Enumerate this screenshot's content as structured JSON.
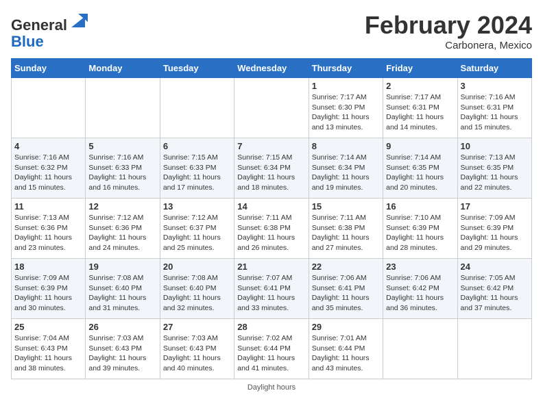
{
  "header": {
    "title": "February 2024",
    "location": "Carbonera, Mexico",
    "logo_line1": "General",
    "logo_line2": "Blue"
  },
  "days_of_week": [
    "Sunday",
    "Monday",
    "Tuesday",
    "Wednesday",
    "Thursday",
    "Friday",
    "Saturday"
  ],
  "weeks": [
    [
      {
        "day": "",
        "sunrise": "",
        "sunset": "",
        "daylight": "",
        "empty": true
      },
      {
        "day": "",
        "sunrise": "",
        "sunset": "",
        "daylight": "",
        "empty": true
      },
      {
        "day": "",
        "sunrise": "",
        "sunset": "",
        "daylight": "",
        "empty": true
      },
      {
        "day": "",
        "sunrise": "",
        "sunset": "",
        "daylight": "",
        "empty": true
      },
      {
        "day": "1",
        "sunrise": "7:17 AM",
        "sunset": "6:30 PM",
        "daylight": "11 hours and 13 minutes."
      },
      {
        "day": "2",
        "sunrise": "7:17 AM",
        "sunset": "6:31 PM",
        "daylight": "11 hours and 14 minutes."
      },
      {
        "day": "3",
        "sunrise": "7:16 AM",
        "sunset": "6:31 PM",
        "daylight": "11 hours and 15 minutes."
      }
    ],
    [
      {
        "day": "4",
        "sunrise": "7:16 AM",
        "sunset": "6:32 PM",
        "daylight": "11 hours and 15 minutes."
      },
      {
        "day": "5",
        "sunrise": "7:16 AM",
        "sunset": "6:33 PM",
        "daylight": "11 hours and 16 minutes."
      },
      {
        "day": "6",
        "sunrise": "7:15 AM",
        "sunset": "6:33 PM",
        "daylight": "11 hours and 17 minutes."
      },
      {
        "day": "7",
        "sunrise": "7:15 AM",
        "sunset": "6:34 PM",
        "daylight": "11 hours and 18 minutes."
      },
      {
        "day": "8",
        "sunrise": "7:14 AM",
        "sunset": "6:34 PM",
        "daylight": "11 hours and 19 minutes."
      },
      {
        "day": "9",
        "sunrise": "7:14 AM",
        "sunset": "6:35 PM",
        "daylight": "11 hours and 20 minutes."
      },
      {
        "day": "10",
        "sunrise": "7:13 AM",
        "sunset": "6:35 PM",
        "daylight": "11 hours and 22 minutes."
      }
    ],
    [
      {
        "day": "11",
        "sunrise": "7:13 AM",
        "sunset": "6:36 PM",
        "daylight": "11 hours and 23 minutes."
      },
      {
        "day": "12",
        "sunrise": "7:12 AM",
        "sunset": "6:36 PM",
        "daylight": "11 hours and 24 minutes."
      },
      {
        "day": "13",
        "sunrise": "7:12 AM",
        "sunset": "6:37 PM",
        "daylight": "11 hours and 25 minutes."
      },
      {
        "day": "14",
        "sunrise": "7:11 AM",
        "sunset": "6:38 PM",
        "daylight": "11 hours and 26 minutes."
      },
      {
        "day": "15",
        "sunrise": "7:11 AM",
        "sunset": "6:38 PM",
        "daylight": "11 hours and 27 minutes."
      },
      {
        "day": "16",
        "sunrise": "7:10 AM",
        "sunset": "6:39 PM",
        "daylight": "11 hours and 28 minutes."
      },
      {
        "day": "17",
        "sunrise": "7:09 AM",
        "sunset": "6:39 PM",
        "daylight": "11 hours and 29 minutes."
      }
    ],
    [
      {
        "day": "18",
        "sunrise": "7:09 AM",
        "sunset": "6:39 PM",
        "daylight": "11 hours and 30 minutes."
      },
      {
        "day": "19",
        "sunrise": "7:08 AM",
        "sunset": "6:40 PM",
        "daylight": "11 hours and 31 minutes."
      },
      {
        "day": "20",
        "sunrise": "7:08 AM",
        "sunset": "6:40 PM",
        "daylight": "11 hours and 32 minutes."
      },
      {
        "day": "21",
        "sunrise": "7:07 AM",
        "sunset": "6:41 PM",
        "daylight": "11 hours and 33 minutes."
      },
      {
        "day": "22",
        "sunrise": "7:06 AM",
        "sunset": "6:41 PM",
        "daylight": "11 hours and 35 minutes."
      },
      {
        "day": "23",
        "sunrise": "7:06 AM",
        "sunset": "6:42 PM",
        "daylight": "11 hours and 36 minutes."
      },
      {
        "day": "24",
        "sunrise": "7:05 AM",
        "sunset": "6:42 PM",
        "daylight": "11 hours and 37 minutes."
      }
    ],
    [
      {
        "day": "25",
        "sunrise": "7:04 AM",
        "sunset": "6:43 PM",
        "daylight": "11 hours and 38 minutes."
      },
      {
        "day": "26",
        "sunrise": "7:03 AM",
        "sunset": "6:43 PM",
        "daylight": "11 hours and 39 minutes."
      },
      {
        "day": "27",
        "sunrise": "7:03 AM",
        "sunset": "6:43 PM",
        "daylight": "11 hours and 40 minutes."
      },
      {
        "day": "28",
        "sunrise": "7:02 AM",
        "sunset": "6:44 PM",
        "daylight": "11 hours and 41 minutes."
      },
      {
        "day": "29",
        "sunrise": "7:01 AM",
        "sunset": "6:44 PM",
        "daylight": "11 hours and 43 minutes."
      },
      {
        "day": "",
        "sunrise": "",
        "sunset": "",
        "daylight": "",
        "empty": true
      },
      {
        "day": "",
        "sunrise": "",
        "sunset": "",
        "daylight": "",
        "empty": true
      }
    ]
  ],
  "footer": "Daylight hours"
}
